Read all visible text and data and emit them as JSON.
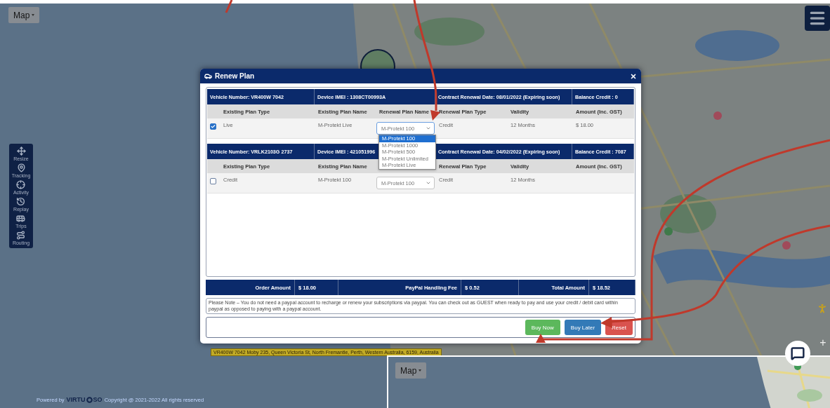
{
  "map_button": {
    "label": "Map"
  },
  "toolbar": [
    {
      "label": "Resize"
    },
    {
      "label": "Tracking"
    },
    {
      "label": "Activity"
    },
    {
      "label": "Replay"
    },
    {
      "label": "Trips"
    },
    {
      "label": "Routing"
    }
  ],
  "vehicle_label": "VR400W 7042 Moby 235, Queen Victoria St, North Fremantle, Perth, Western Australia, 6159, Australia",
  "modal": {
    "title": "Renew Plan",
    "vehicles": [
      {
        "vehicle_number": "Vehicle Number: VR400W 7042",
        "device_imei": "Device IMEI : 1308CT00993A",
        "contract": "Contract Renewal Date: 08/01/2022 (Expiring soon)",
        "balance": "Balance Credit : 0",
        "headers": {
          "existing_plan_type": "Existing Plan Type",
          "existing_plan_name": "Existing Plan Name",
          "renewal_plan_name": "Renewal Plan Name",
          "renewal_plan_type": "Renewal Plan Type",
          "validity": "Validity",
          "amount": "Amount (Inc. GST)"
        },
        "checked": true,
        "existing_plan_type": "Live",
        "existing_plan_name": "M-Protekt Live",
        "renewal_plan_name": "M-Protekt 100",
        "renewal_plan_type": "Credit",
        "validity": "12 Months",
        "amount": "$ 18.00",
        "expanded": true,
        "options": [
          {
            "label": "M-Protekt 100",
            "selected": true
          },
          {
            "label": "M-Protekt 1000",
            "selected": false
          },
          {
            "label": "M-Protekt 500",
            "selected": false
          },
          {
            "label": "M-Protekt Unlimited",
            "selected": false
          },
          {
            "label": "M-Protekt Live",
            "selected": false
          }
        ]
      },
      {
        "vehicle_number": "Vehicle Number: VRLK2103G 2737",
        "device_imei": "Device IMEI : 421051996",
        "contract": "Contract Renewal Date: 04/02/2022 (Expiring soon)",
        "balance": "Balance Credit : 7087",
        "headers": {
          "existing_plan_type": "Existing Plan Type",
          "existing_plan_name": "Existing Plan Name",
          "renewal_plan_type": "Renewal Plan Type",
          "validity": "Validity",
          "amount": "Amount (Inc. GST)"
        },
        "checked": false,
        "existing_plan_type": "Credit",
        "existing_plan_name": "M-Protekt 100",
        "renewal_plan_name": "M-Protekt 100",
        "renewal_plan_type": "Credit",
        "validity": "12 Months",
        "expanded": false
      }
    ],
    "totals": [
      {
        "label": "Order Amount",
        "value": "$ 18.00"
      },
      {
        "label": "PayPal Handling Fee",
        "value": "$ 0.52"
      },
      {
        "label": "Total Amount",
        "value": "$ 18.52"
      }
    ],
    "note": "Please Note – You do not need a paypal account to recharge or renew your subscriptions via paypal. You can check out as GUEST when ready to pay and use your credit / debit card within paypal as opposed to paying with a paypal account.",
    "buttons": [
      {
        "label": "Buy Now",
        "kind": "success"
      },
      {
        "label": "Buy Later",
        "kind": "primary"
      },
      {
        "label": "Reset",
        "kind": "danger"
      }
    ]
  },
  "zoom_in": "+",
  "footer": {
    "powered": "Powered by",
    "brand_start": "VIRTU",
    "brand_end": "SO",
    "copyright": "Copyright @ 2021-2022 All rights reserved"
  },
  "inset": {
    "map_button": {
      "label": "Map"
    }
  }
}
